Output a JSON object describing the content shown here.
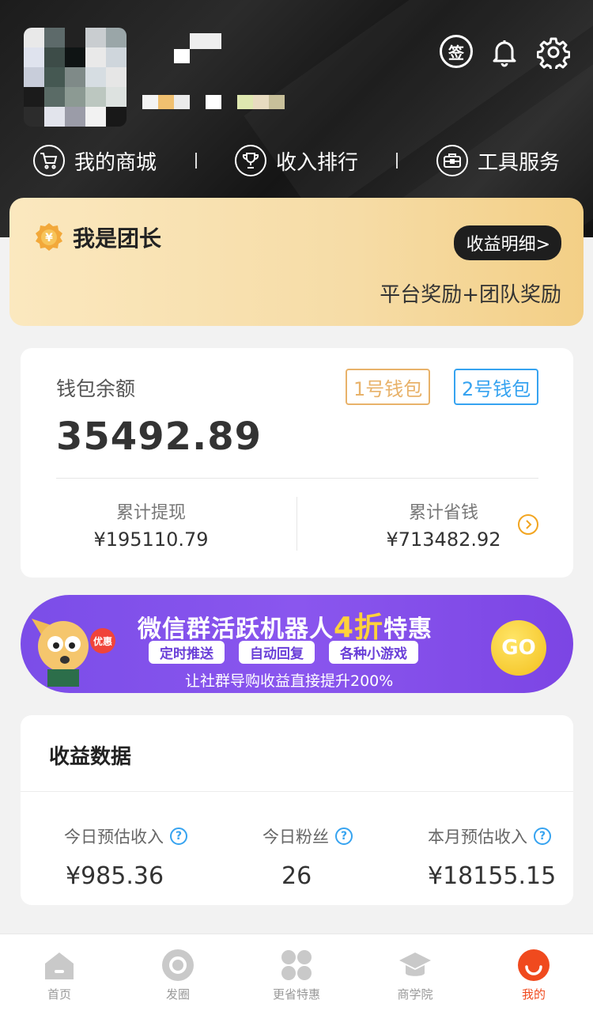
{
  "header": {
    "sign_label": "签",
    "quick_nav": [
      {
        "label": "我的商城",
        "icon": "cart-icon"
      },
      {
        "label": "收入排行",
        "icon": "trophy-icon"
      },
      {
        "label": "工具服务",
        "icon": "toolbox-icon"
      }
    ]
  },
  "leader": {
    "title": "我是团长",
    "detail_button": "收益明细>",
    "subtitle": "平台奖励+团队奖励",
    "badge_symbol": "¥"
  },
  "wallet": {
    "label": "钱包余额",
    "wallet1": "1号钱包",
    "wallet2": "2号钱包",
    "balance": "35492.89",
    "withdraw_label": "累计提现",
    "withdraw_value": "¥195110.79",
    "saved_label": "累计省钱",
    "saved_value": "¥713482.92"
  },
  "banner": {
    "title_part1": "微信群活跃机器人",
    "title_highlight": "4折",
    "title_part2": "特惠",
    "tags": [
      "定时推送",
      "自动回复",
      "各种小游戏"
    ],
    "subtitle": "让社群导购收益直接提升200%",
    "go_label": "GO",
    "mascot_badge": "优惠"
  },
  "earnings": {
    "title": "收益数据",
    "today_income_label": "今日预估收入",
    "today_income_value": "¥985.36",
    "today_fans_label": "今日粉丝",
    "today_fans_value": "26",
    "month_income_label": "本月预估收入",
    "month_income_value": "¥18155.15"
  },
  "bottom_nav": [
    {
      "label": "首页",
      "icon": "home-icon"
    },
    {
      "label": "发圈",
      "icon": "circle-icon"
    },
    {
      "label": "更省特惠",
      "icon": "grid-icon"
    },
    {
      "label": "商学院",
      "icon": "graduation-cap-icon"
    },
    {
      "label": "我的",
      "icon": "profile-icon",
      "active": true
    }
  ],
  "colors": {
    "accent_orange": "#f04a1e",
    "gold": "#e8b26a",
    "blue": "#36a3f0",
    "banner_purple": "#7b4de8"
  }
}
